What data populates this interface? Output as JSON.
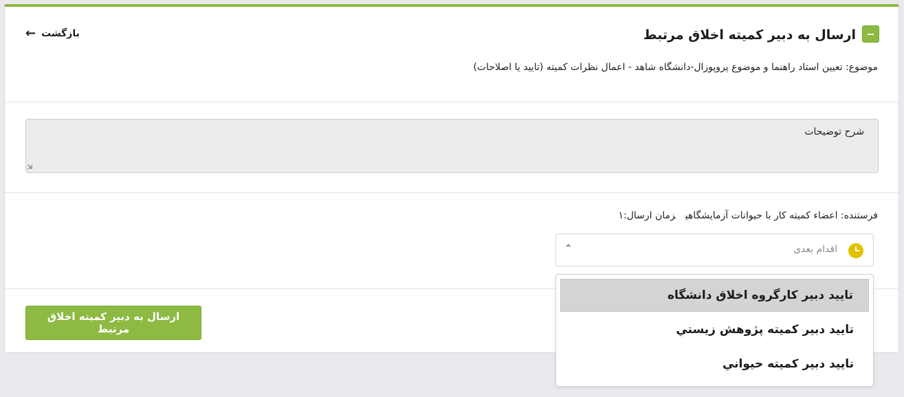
{
  "header": {
    "title": "ارسال به دبير كميته اخلاق مرتبط",
    "back_label": "بازگشت"
  },
  "subject": {
    "text": "موضوع: تعیین استاد راهنما و موضوع پروپوزال-دانشگاه شاهد - اعمال نظرات کمیته (تایید یا اصلاحات)"
  },
  "description": {
    "placeholder": "شرح توضیحات"
  },
  "sender": {
    "sender_text": "فرستنده: اعضاء كميته كار با حيوانات آزمايشگاهي",
    "time_text": "زمان ارسال:١"
  },
  "next_action": {
    "placeholder": "اقدام بعدی",
    "options": [
      "تایید دبیر کارگروه اخلاق دانشگاه",
      "تاييد دبير كميته پژوهش زيستي",
      "تاييد دبير كميته حيواني"
    ]
  },
  "actions": {
    "submit_label": "ارسال به دبير كميته اخلاق مرتبط"
  },
  "colors": {
    "accent": "#8cba42",
    "clock": "#e2c200",
    "selected_option": "#d4d4d7",
    "background": "#e9e9ee"
  }
}
